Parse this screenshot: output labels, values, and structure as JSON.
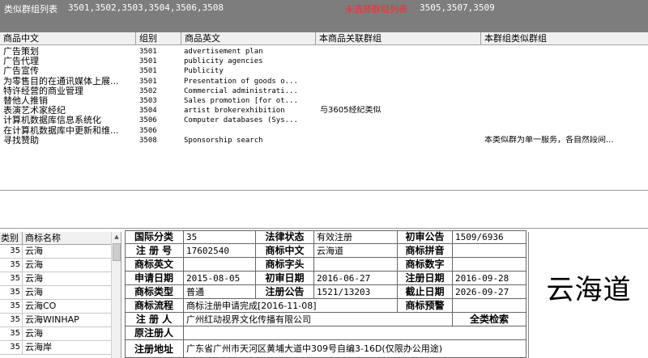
{
  "topbar": {
    "similar_label": "类似群组列表",
    "similar_codes": "3501,3502,3503,3504,3506,3508",
    "unselected_label": "未选择群组列表",
    "unselected_codes": "3505,3507,3509",
    "colors": {
      "background": "#7d7d7d",
      "unselected_label": "#ff2a2a"
    }
  },
  "goods": {
    "columns": [
      "商品中文",
      "组别",
      "商品英文",
      "本商品关联群组",
      "本群组类似群组"
    ],
    "rows": [
      {
        "name": "广告策划",
        "group": "3501",
        "english": "advertisement plan",
        "related": "",
        "similar": ""
      },
      {
        "name": "广告代理",
        "group": "3501",
        "english": "publicity agencies",
        "related": "",
        "similar": ""
      },
      {
        "name": "广告宣传",
        "group": "3501",
        "english": "Publicity",
        "related": "",
        "similar": ""
      },
      {
        "name": "为零售目的在通讯媒体上展...",
        "group": "3501",
        "english": "Presentation of goods o...",
        "related": "",
        "similar": ""
      },
      {
        "name": "特许经营的商业管理",
        "group": "3502",
        "english": "Commercial administrati...",
        "related": "",
        "similar": ""
      },
      {
        "name": "替他人推销",
        "group": "3503",
        "english": "Sales promotion [for ot...",
        "related": "",
        "similar": ""
      },
      {
        "name": "表演艺术家经纪",
        "group": "3504",
        "english": "artist brokerexhibition",
        "related": "与3605经纪类似",
        "similar": ""
      },
      {
        "name": "计算机数据库信息系统化",
        "group": "3506",
        "english": "Computer databases (Sys...",
        "related": "",
        "similar": ""
      },
      {
        "name": "在计算机数据库中更新和维...",
        "group": "3506",
        "english": "",
        "related": "",
        "similar": ""
      },
      {
        "name": "寻找赞助",
        "group": "3508",
        "english": "Sponsorship search",
        "related": "",
        "similar": "本类似群为单一服务，各自然段间..."
      }
    ]
  },
  "marks_list": {
    "columns": [
      "类别",
      "商标名称"
    ],
    "rows": [
      {
        "class": "35",
        "name": "云海"
      },
      {
        "class": "35",
        "name": "云海"
      },
      {
        "class": "35",
        "name": "云海"
      },
      {
        "class": "35",
        "name": "云海"
      },
      {
        "class": "35",
        "name": "云海CO"
      },
      {
        "class": "35",
        "name": "云海WINHAP"
      },
      {
        "class": "35",
        "name": "云海"
      },
      {
        "class": "35",
        "name": "云海岸"
      }
    ],
    "scroll_up_icon": "▲"
  },
  "detail": {
    "intl_class_label": "国际分类",
    "intl_class": "35",
    "law_status_label": "法律状态",
    "law_status": "有效注册",
    "prelim_pub_label": "初审公告",
    "prelim_pub": "1509/6936",
    "reg_no_label": "注 册 号",
    "reg_no": "17602540",
    "mark_cn_label": "商标中文",
    "mark_cn": "云海道",
    "mark_pinyin_label": "商标拼音",
    "mark_pinyin": "",
    "mark_en_label": "商标英文",
    "mark_en": "",
    "mark_letters_label": "商标字头",
    "mark_letters": "",
    "mark_digits_label": "商标数字",
    "mark_digits": "",
    "apply_date_label": "申请日期",
    "apply_date": "2015-08-05",
    "prelim_date_label": "初审日期",
    "prelim_date": "2016-06-27",
    "reg_date_label": "注册日期",
    "reg_date": "2016-09-28",
    "mark_type_label": "商标类型",
    "mark_type": "普通",
    "reg_pub_label": "注册公告",
    "reg_pub": "1521/13203",
    "expiry_label": "截止日期",
    "expiry": "2026-09-27",
    "process_label": "商标流程",
    "process": "商标注册申请完成[2016-11-08]",
    "warning_label": "商标预警",
    "warning": "",
    "registrant_label": "注 册 人",
    "registrant": "广州红动视界文化传播有限公司",
    "full_search_label": "全类检索",
    "orig_registrant_label": "原注册人",
    "orig_registrant": "",
    "address_label": "注册地址",
    "address": "广东省广州市天河区黄埔大道中309号自编3-16D(仅限办公用途)"
  },
  "mark_image": {
    "text": "云海道"
  }
}
